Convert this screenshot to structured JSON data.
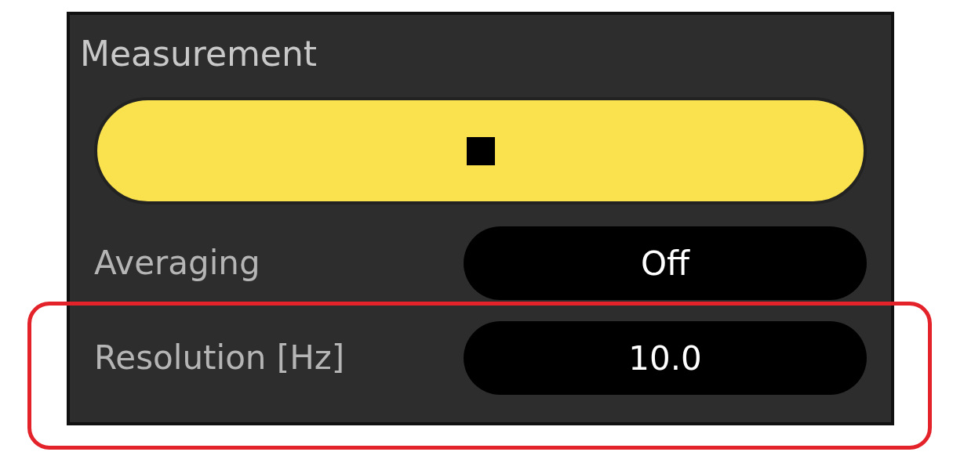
{
  "panel": {
    "title": "Measurement"
  },
  "run_button": {
    "kind": "stop"
  },
  "settings": [
    {
      "label": "Averaging",
      "value": "Off",
      "highlighted": false
    },
    {
      "label": "Resolution [Hz]",
      "value": "10.0",
      "highlighted": true
    }
  ]
}
